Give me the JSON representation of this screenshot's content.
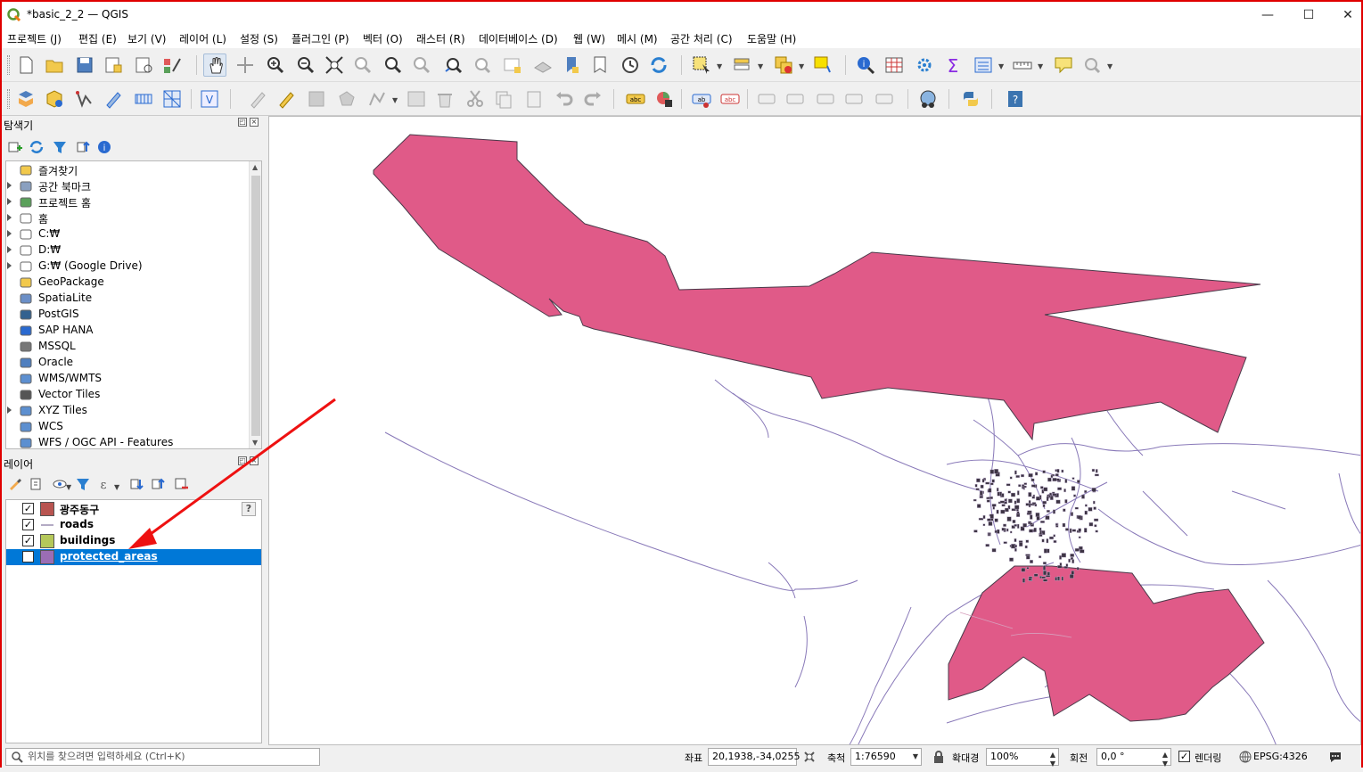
{
  "window": {
    "title": "*basic_2_2 — QGIS",
    "minimize": "—",
    "maximize": "☐",
    "close": "✕"
  },
  "menu": [
    "프로젝트 (J)",
    "편집 (E)",
    "보기 (V)",
    "레이어 (L)",
    "설정 (S)",
    "플러그인 (P)",
    "벡터 (O)",
    "래스터 (R)",
    "데이터베이스 (D)",
    "웹 (W)",
    "메시 (M)",
    "공간 처리 (C)",
    "도움말 (H)"
  ],
  "browser": {
    "title": "탐색기",
    "items": [
      {
        "label": "즐겨찾기",
        "icon": "star-icon",
        "expandable": false
      },
      {
        "label": "공간 북마크",
        "icon": "bookmark-icon",
        "expandable": true
      },
      {
        "label": "프로젝트 홈",
        "icon": "project-home-icon",
        "expandable": true
      },
      {
        "label": "홈",
        "icon": "home-icon",
        "expandable": true
      },
      {
        "label": "C:₩",
        "icon": "folder-icon",
        "expandable": true
      },
      {
        "label": "D:₩",
        "icon": "folder-icon",
        "expandable": true
      },
      {
        "label": "G:₩ (Google Drive)",
        "icon": "folder-icon",
        "expandable": true
      },
      {
        "label": "GeoPackage",
        "icon": "geopackage-icon",
        "expandable": false
      },
      {
        "label": "SpatiaLite",
        "icon": "spatialite-icon",
        "expandable": false
      },
      {
        "label": "PostGIS",
        "icon": "postgis-icon",
        "expandable": false
      },
      {
        "label": "SAP HANA",
        "icon": "sap-hana-icon",
        "expandable": false
      },
      {
        "label": "MSSQL",
        "icon": "mssql-icon",
        "expandable": false
      },
      {
        "label": "Oracle",
        "icon": "oracle-icon",
        "expandable": false
      },
      {
        "label": "WMS/WMTS",
        "icon": "wms-icon",
        "expandable": false
      },
      {
        "label": "Vector Tiles",
        "icon": "vector-tiles-icon",
        "expandable": false
      },
      {
        "label": "XYZ Tiles",
        "icon": "xyz-tiles-icon",
        "expandable": true
      },
      {
        "label": "WCS",
        "icon": "wcs-icon",
        "expandable": false
      },
      {
        "label": "WFS / OGC API - Features",
        "icon": "wfs-icon",
        "expandable": false
      }
    ]
  },
  "layers": {
    "title": "레이어",
    "items": [
      {
        "label": "광주동구",
        "symbol": "fill",
        "color": "#b85450",
        "checked": true,
        "selected": false
      },
      {
        "label": "roads",
        "symbol": "line",
        "color": "#9b8fb0",
        "checked": true,
        "selected": false
      },
      {
        "label": "buildings",
        "symbol": "fill",
        "color": "#b5c85a",
        "checked": true,
        "selected": false
      },
      {
        "label": "protected_areas",
        "symbol": "fill",
        "color": "#9b6db5",
        "checked": true,
        "selected": true
      }
    ],
    "help_badge": "?"
  },
  "map": {
    "protected_color": "#e05a88",
    "road_color": "#8878b8",
    "annotation_color": "#ee1111"
  },
  "status": {
    "locator_placeholder": "위치를 찾으려면 입력하세요 (Ctrl+K)",
    "coord_label": "좌표",
    "coord_value": "20,1938,-34,0255",
    "scale_label": "축척",
    "scale_value": "1:76590",
    "magnifier_label": "확대경",
    "magnifier_value": "100%",
    "rotation_label": "회전",
    "rotation_value": "0,0 °",
    "render_label": "렌더링",
    "crs": "EPSG:4326"
  }
}
